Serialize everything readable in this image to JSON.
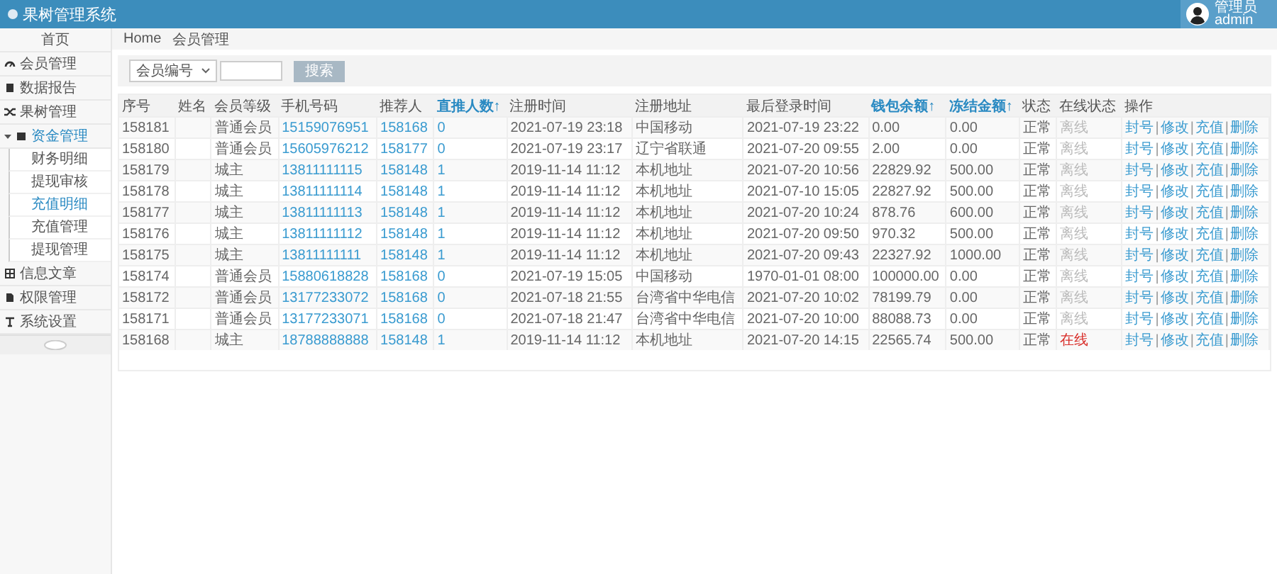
{
  "header": {
    "title": "果树管理系统",
    "user_role": "管理员",
    "user_name": "admin"
  },
  "sidebar": {
    "items": [
      {
        "label": "首页",
        "selected": false
      },
      {
        "label": "会员管理",
        "selected": false
      },
      {
        "label": "数据报告",
        "selected": false
      },
      {
        "label": "果树管理",
        "selected": false
      },
      {
        "label": "资金管理",
        "selected": true,
        "expanded": true,
        "children": [
          {
            "label": "财务明细",
            "selected": false
          },
          {
            "label": "提现审核",
            "selected": false
          },
          {
            "label": "充值明细",
            "selected": true
          },
          {
            "label": "充值管理",
            "selected": false
          },
          {
            "label": "提现管理",
            "selected": false
          }
        ]
      },
      {
        "label": "信息文章",
        "selected": false
      },
      {
        "label": "权限管理",
        "selected": false
      },
      {
        "label": "系统设置",
        "selected": false
      }
    ]
  },
  "breadcrumb": [
    "Home",
    "会员管理"
  ],
  "search": {
    "select": "会员编号",
    "button": "搜索"
  },
  "table": {
    "columns": [
      {
        "label": "序号",
        "sortable": false
      },
      {
        "label": "姓名",
        "sortable": false
      },
      {
        "label": "会员等级",
        "sortable": false
      },
      {
        "label": "手机号码",
        "sortable": false
      },
      {
        "label": "推荐人",
        "sortable": false
      },
      {
        "label": "直推人数↑",
        "sortable": true
      },
      {
        "label": "注册时间",
        "sortable": false
      },
      {
        "label": "注册地址",
        "sortable": false
      },
      {
        "label": "最后登录时间",
        "sortable": false
      },
      {
        "label": "钱包余额↑",
        "sortable": true
      },
      {
        "label": "冻结金额↑",
        "sortable": true
      },
      {
        "label": "状态",
        "sortable": false
      },
      {
        "label": "在线状态",
        "sortable": false
      },
      {
        "label": "操作",
        "sortable": false
      }
    ],
    "rows": [
      {
        "id": "158181",
        "level": "普通会员",
        "phone": "15159076951",
        "referrer": "158168",
        "direct": "0",
        "registered": "2021-07-19 23:18",
        "address": "中国移动",
        "last_login": "2021-07-19 23:22",
        "balance": "0.00",
        "frozen": "0.00",
        "status": "正常",
        "online_label": "离线",
        "online": false,
        "actions": [
          "封号",
          "|",
          "修改",
          "|",
          "充值",
          "|",
          "删除"
        ]
      },
      {
        "id": "158180",
        "level": "普通会员",
        "phone": "15605976212",
        "referrer": "158177",
        "direct": "0",
        "registered": "2021-07-19 23:17",
        "address": "辽宁省联通",
        "last_login": "2021-07-20 09:55",
        "balance": "2.00",
        "frozen": "0.00",
        "status": "正常",
        "online_label": "离线",
        "online": false,
        "actions": [
          "封号",
          "|",
          "修改",
          "|",
          "充值",
          "|",
          "删除"
        ]
      },
      {
        "id": "158179",
        "level": "城主",
        "phone": "13811111115",
        "referrer": "158148",
        "direct": "1",
        "registered": "2019-11-14 11:12",
        "address": "本机地址",
        "last_login": "2021-07-20 10:56",
        "balance": "22829.92",
        "frozen": "500.00",
        "status": "正常",
        "online_label": "离线",
        "online": false,
        "actions": [
          "封号",
          "|",
          "修改",
          "|",
          "充值",
          "|",
          "删除"
        ]
      },
      {
        "id": "158178",
        "level": "城主",
        "phone": "13811111114",
        "referrer": "158148",
        "direct": "1",
        "registered": "2019-11-14 11:12",
        "address": "本机地址",
        "last_login": "2021-07-10 15:05",
        "balance": "22827.92",
        "frozen": "500.00",
        "status": "正常",
        "online_label": "离线",
        "online": false,
        "actions": [
          "封号",
          "|",
          "修改",
          "|",
          "充值",
          "|",
          "删除"
        ]
      },
      {
        "id": "158177",
        "level": "城主",
        "phone": "13811111113",
        "referrer": "158148",
        "direct": "1",
        "registered": "2019-11-14 11:12",
        "address": "本机地址",
        "last_login": "2021-07-20 10:24",
        "balance": "878.76",
        "frozen": "600.00",
        "status": "正常",
        "online_label": "离线",
        "online": false,
        "actions": [
          "封号",
          "|",
          "修改",
          "|",
          "充值",
          "|",
          "删除"
        ]
      },
      {
        "id": "158176",
        "level": "城主",
        "phone": "13811111112",
        "referrer": "158148",
        "direct": "1",
        "registered": "2019-11-14 11:12",
        "address": "本机地址",
        "last_login": "2021-07-20 09:50",
        "balance": "970.32",
        "frozen": "500.00",
        "status": "正常",
        "online_label": "离线",
        "online": false,
        "actions": [
          "封号",
          "|",
          "修改",
          "|",
          "充值",
          "|",
          "删除"
        ]
      },
      {
        "id": "158175",
        "level": "城主",
        "phone": "13811111111",
        "referrer": "158148",
        "direct": "1",
        "registered": "2019-11-14 11:12",
        "address": "本机地址",
        "last_login": "2021-07-20 09:43",
        "balance": "22327.92",
        "frozen": "1000.00",
        "status": "正常",
        "online_label": "离线",
        "online": false,
        "actions": [
          "封号",
          "|",
          "修改",
          "|",
          "充值",
          "|",
          "删除"
        ]
      },
      {
        "id": "158174",
        "level": "普通会员",
        "phone": "15880618828",
        "referrer": "158168",
        "direct": "0",
        "registered": "2021-07-19 15:05",
        "address": "中国移动",
        "last_login": "1970-01-01 08:00",
        "balance": "100000.00",
        "frozen": "0.00",
        "status": "正常",
        "online_label": "离线",
        "online": false,
        "actions": [
          "封号",
          "|",
          "修改",
          "|",
          "充值",
          "|",
          "删除"
        ]
      },
      {
        "id": "158172",
        "level": "普通会员",
        "phone": "13177233072",
        "referrer": "158168",
        "direct": "0",
        "registered": "2021-07-18 21:55",
        "address": "台湾省中华电信",
        "last_login": "2021-07-20 10:02",
        "balance": "78199.79",
        "frozen": "0.00",
        "status": "正常",
        "online_label": "离线",
        "online": false,
        "actions": [
          "封号",
          "|",
          "修改",
          "|",
          "充值",
          "|",
          "删除"
        ]
      },
      {
        "id": "158171",
        "level": "普通会员",
        "phone": "13177233071",
        "referrer": "158168",
        "direct": "0",
        "registered": "2021-07-18 21:47",
        "address": "台湾省中华电信",
        "last_login": "2021-07-20 10:00",
        "balance": "88088.73",
        "frozen": "0.00",
        "status": "正常",
        "online_label": "离线",
        "online": false,
        "actions": [
          "封号",
          "|",
          "修改",
          "|",
          "充值",
          "|",
          "删除"
        ]
      },
      {
        "id": "158168",
        "level": "城主",
        "phone": "18788888888",
        "referrer": "158148",
        "direct": "1",
        "registered": "2019-11-14 11:12",
        "address": "本机地址",
        "last_login": "2021-07-20 14:15",
        "balance": "22565.74",
        "frozen": "500.00",
        "status": "正常",
        "online_label": "在线",
        "online": true,
        "actions": [
          "封号",
          "|",
          "修改",
          "|",
          "充值",
          "|",
          "删除"
        ]
      }
    ]
  }
}
